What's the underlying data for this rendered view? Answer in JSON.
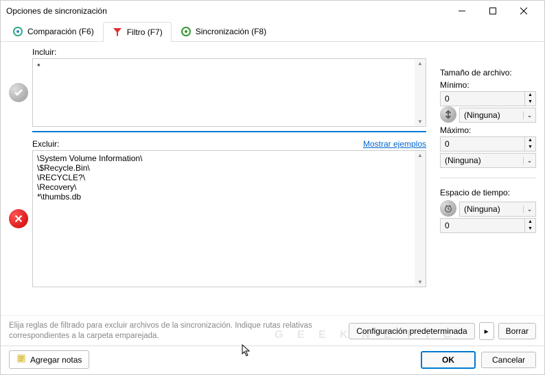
{
  "window": {
    "title": "Opciones de sincronización"
  },
  "tabs": {
    "compare": "Comparación (F6)",
    "filter": "Filtro (F7)",
    "sync": "Sincronización (F8)"
  },
  "include": {
    "label": "Incluir:",
    "value": "*"
  },
  "exclude": {
    "label": "Excluir:",
    "examples_link": "Mostrar ejemplos",
    "value": "\\System Volume Information\\\n\\$Recycle.Bin\\\n\\RECYCLE?\\\n\\Recovery\\\n*\\thumbs.db"
  },
  "filesize": {
    "header": "Tamaño de archivo:",
    "min_label": "Mínimo:",
    "min_value": "0",
    "min_unit": "(Ninguna)",
    "max_label": "Máximo:",
    "max_value": "0",
    "max_unit": "(Ninguna)"
  },
  "timespan": {
    "header": "Espacio de tiempo:",
    "unit": "(Ninguna)",
    "value": "0"
  },
  "hint": "Elija reglas de filtrado para excluir archivos de la sincronización. Indique rutas relativas correspondientes a la carpeta emparejada.",
  "buttons": {
    "default_config": "Configuración predeterminada",
    "clear": "Borrar",
    "add_notes": "Agregar notas",
    "ok": "OK",
    "cancel": "Cancelar"
  },
  "watermark": "G E E K N E T I C"
}
